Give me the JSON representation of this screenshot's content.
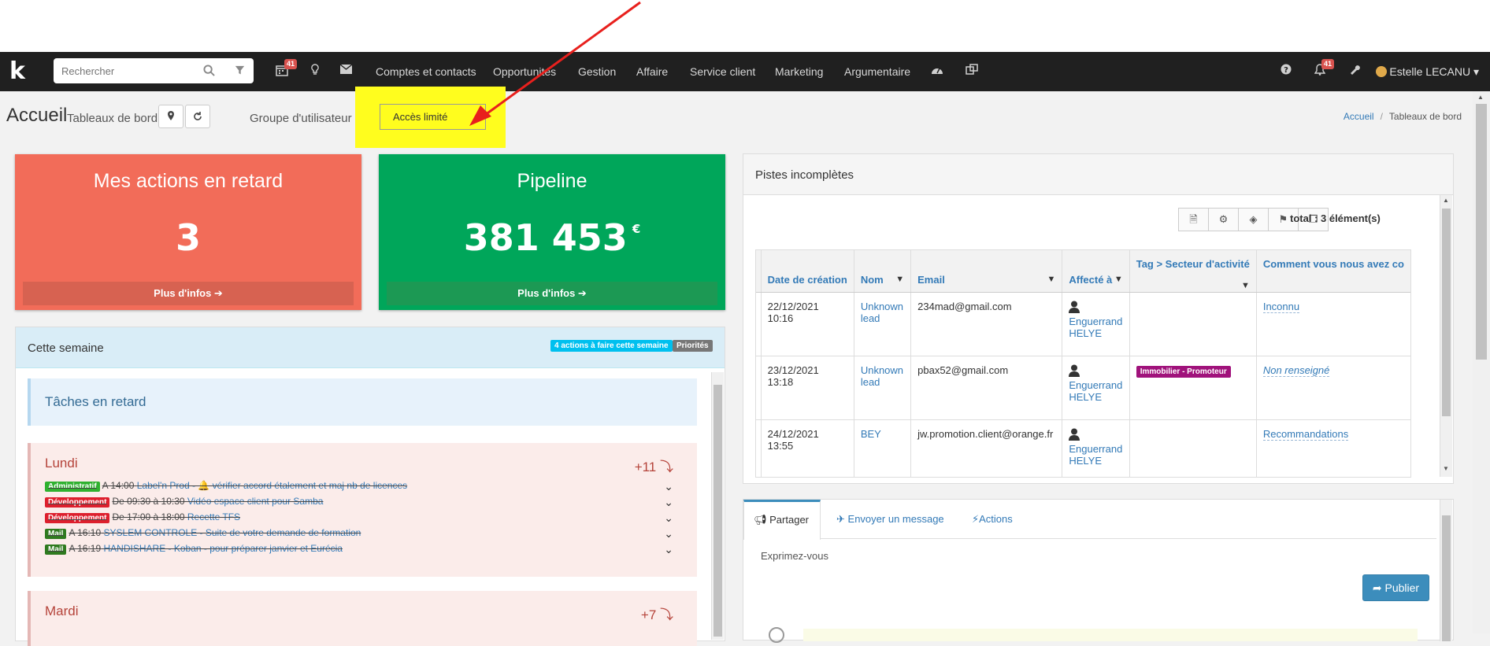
{
  "navbar": {
    "logo": "k",
    "search_placeholder": "Rechercher",
    "calendar_badge": "41",
    "notif_badge": "41",
    "links": [
      "Comptes et contacts",
      "Opportunités",
      "Gestion",
      "Affaire",
      "Service client",
      "Marketing",
      "Argumentaire"
    ],
    "user": "Estelle LECANU ▾"
  },
  "header": {
    "title": "Accueil",
    "subtitle": "Tableaux de bord",
    "group_label": "Groupe d'utilisateur",
    "group_value": "Accès limité",
    "breadcrumb": [
      "Accueil",
      "Tableaux de bord"
    ]
  },
  "kpi": {
    "late": {
      "title": "Mes actions en retard",
      "value": "3",
      "more": "Plus d'infos ➔"
    },
    "pipeline": {
      "title": "Pipeline",
      "value": "381 453",
      "unit": "€",
      "more": "Plus d'infos ➔"
    }
  },
  "week": {
    "title": "Cette semaine",
    "badge_todo": "4 actions à faire cette semaine",
    "badge_prio": "Priorités",
    "late_title": "Tâches en retard",
    "days": [
      {
        "name": "Lundi",
        "count": "+11 ⤵",
        "tasks": [
          {
            "tag": "Administratif",
            "tagcolor": "#2fb12f",
            "time": "A 14:00",
            "text": "Label'n Prod - 🔔 vérifier accord étalement et maj nb de licences"
          },
          {
            "tag": "Développement",
            "tagcolor": "#dd1f2d",
            "time": "De 09:30 à 10:30",
            "text": "Vidéo espace client pour Samba"
          },
          {
            "tag": "Développement",
            "tagcolor": "#dd1f2d",
            "time": "De 17:00 à 18:00",
            "text": "Recette TFS"
          },
          {
            "tag": "Mail",
            "tagcolor": "#2f7a1f",
            "time": "A 16:10",
            "text": "SYSLEM CONTROLE - Suite de votre demande de formation"
          },
          {
            "tag": "Mail",
            "tagcolor": "#2f7a1f",
            "time": "A 16:19",
            "text": "HANDISHARE - Koban - pour préparer janvier et Eurécia"
          }
        ]
      },
      {
        "name": "Mardi",
        "count": "+7 ⤵",
        "tasks": []
      }
    ]
  },
  "pistes": {
    "title": "Pistes incomplètes",
    "total": "total : 3 élément(s)",
    "columns": [
      "Date de création",
      "Nom",
      "Email",
      "Affecté à",
      "Tag > Secteur d'activité",
      "Comment vous nous avez co"
    ],
    "rows": [
      {
        "date": "22/12/2021 10:16",
        "nom": "Unknown lead",
        "email": "234mad@gmail.com",
        "affecte": "Enguerrand HELYE",
        "tag": "",
        "comment": "Inconnu",
        "comment_italic": false
      },
      {
        "date": "23/12/2021 13:18",
        "nom": "Unknown lead",
        "email": "pbax52@gmail.com",
        "affecte": "Enguerrand HELYE",
        "tag": "Immobilier - Promoteur",
        "comment": "Non renseigné",
        "comment_italic": true
      },
      {
        "date": "24/12/2021 13:55",
        "nom": "BEY",
        "email": "jw.promotion.client@orange.fr",
        "affecte": "Enguerrand HELYE",
        "tag": "",
        "comment": "Recommandations",
        "comment_italic": false
      }
    ]
  },
  "share": {
    "tabs": [
      "Partager",
      "Envoyer un message",
      "Actions"
    ],
    "placeholder": "Exprimez-vous",
    "publish": "Publier"
  }
}
